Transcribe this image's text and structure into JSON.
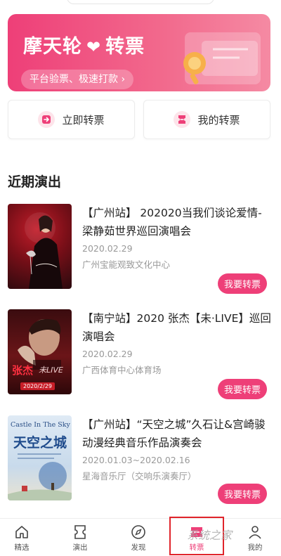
{
  "banner": {
    "title_left": "摩天轮",
    "title_right": "转票",
    "subtitle": "平台验票、极速打款 ›"
  },
  "actions": {
    "transfer_label": "立即转票",
    "my_tickets_label": "我的转票"
  },
  "section": {
    "title": "近期演出"
  },
  "events": [
    {
      "title": "【广州站】 202020当我们谈论爱情-梁静茹世界巡回演唱会",
      "date": "2020.02.29",
      "venue": "广州宝能观致文化中心",
      "button": "我要转票"
    },
    {
      "title": "【南宁站】2020 张杰【未·LIVE】巡回演唱会",
      "date": "2020.02.29",
      "venue": "广西体育中心体育场",
      "button": "我要转票"
    },
    {
      "title": "【广州站】“天空之城”久石让&宫崎骏动漫经典音乐作品演奏会",
      "date": "2020.01.03~2020.02.16",
      "venue": "星海音乐厅（交响乐演奏厅）",
      "button": "我要转票"
    }
  ],
  "posters": {
    "p2_name": "张杰",
    "p2_live": "未LIVE",
    "p2_date": "2020/2/29",
    "p3_en": "Castle In The Sky",
    "p3_cn": "天空之城"
  },
  "tabs": [
    {
      "label": "精选",
      "icon": "home-icon"
    },
    {
      "label": "演出",
      "icon": "ticket-icon"
    },
    {
      "label": "发现",
      "icon": "compass-icon"
    },
    {
      "label": "转票",
      "icon": "transfer-icon"
    },
    {
      "label": "我的",
      "icon": "user-icon"
    }
  ],
  "watermark": "系统之家",
  "colors": {
    "accent": "#ee3f78",
    "highlight": "#e0242b"
  }
}
